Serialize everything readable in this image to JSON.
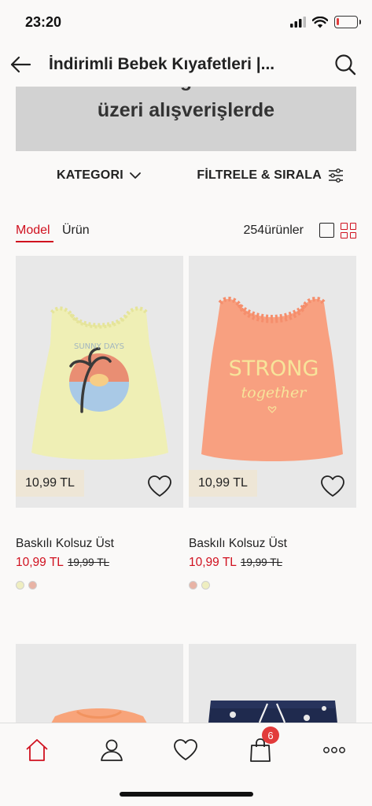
{
  "status_bar": {
    "time": "23:20",
    "battery_level": 0.12
  },
  "nav": {
    "title": "İndirimli Bebek Kıyafetleri |...",
    "back_icon": "arrow-left-icon",
    "search_icon": "search-icon"
  },
  "promo": {
    "text": "üzeri alışverişlerde"
  },
  "filters": {
    "category_label": "KATEGORI",
    "filter_label": "FİLTRELE & SIRALA"
  },
  "view": {
    "tab_model": "Model",
    "tab_product": "Ürün",
    "count": "254ürünler",
    "active_tab": "Model",
    "active_layout": "grid"
  },
  "products": [
    {
      "name": "Baskılı Kolsuz Üst",
      "chip_price": "10,99 TL",
      "sale_price": "10,99 TL",
      "old_price": "19,99 TL",
      "swatches": [
        "#efeec0",
        "#e8b3a5"
      ],
      "image_desc_colors": {
        "shirt": "#efefb5",
        "print": "#e98e73"
      }
    },
    {
      "name": "Baskılı Kolsuz Üst",
      "chip_price": "10,99 TL",
      "sale_price": "10,99 TL",
      "old_price": "19,99 TL",
      "swatches": [
        "#e8b3a5",
        "#efeec0"
      ],
      "image_desc_colors": {
        "shirt": "#f8a080",
        "print": "#f7e49a"
      }
    }
  ],
  "tab_bar": {
    "items": [
      "home-icon",
      "account-icon",
      "favorites-icon",
      "bag-icon",
      "more-icon"
    ],
    "cart_count": "6",
    "active": "home-icon"
  },
  "colors": {
    "accent": "#d0111f",
    "badge": "#e23b3b",
    "price_chip": "#eee6d6"
  }
}
